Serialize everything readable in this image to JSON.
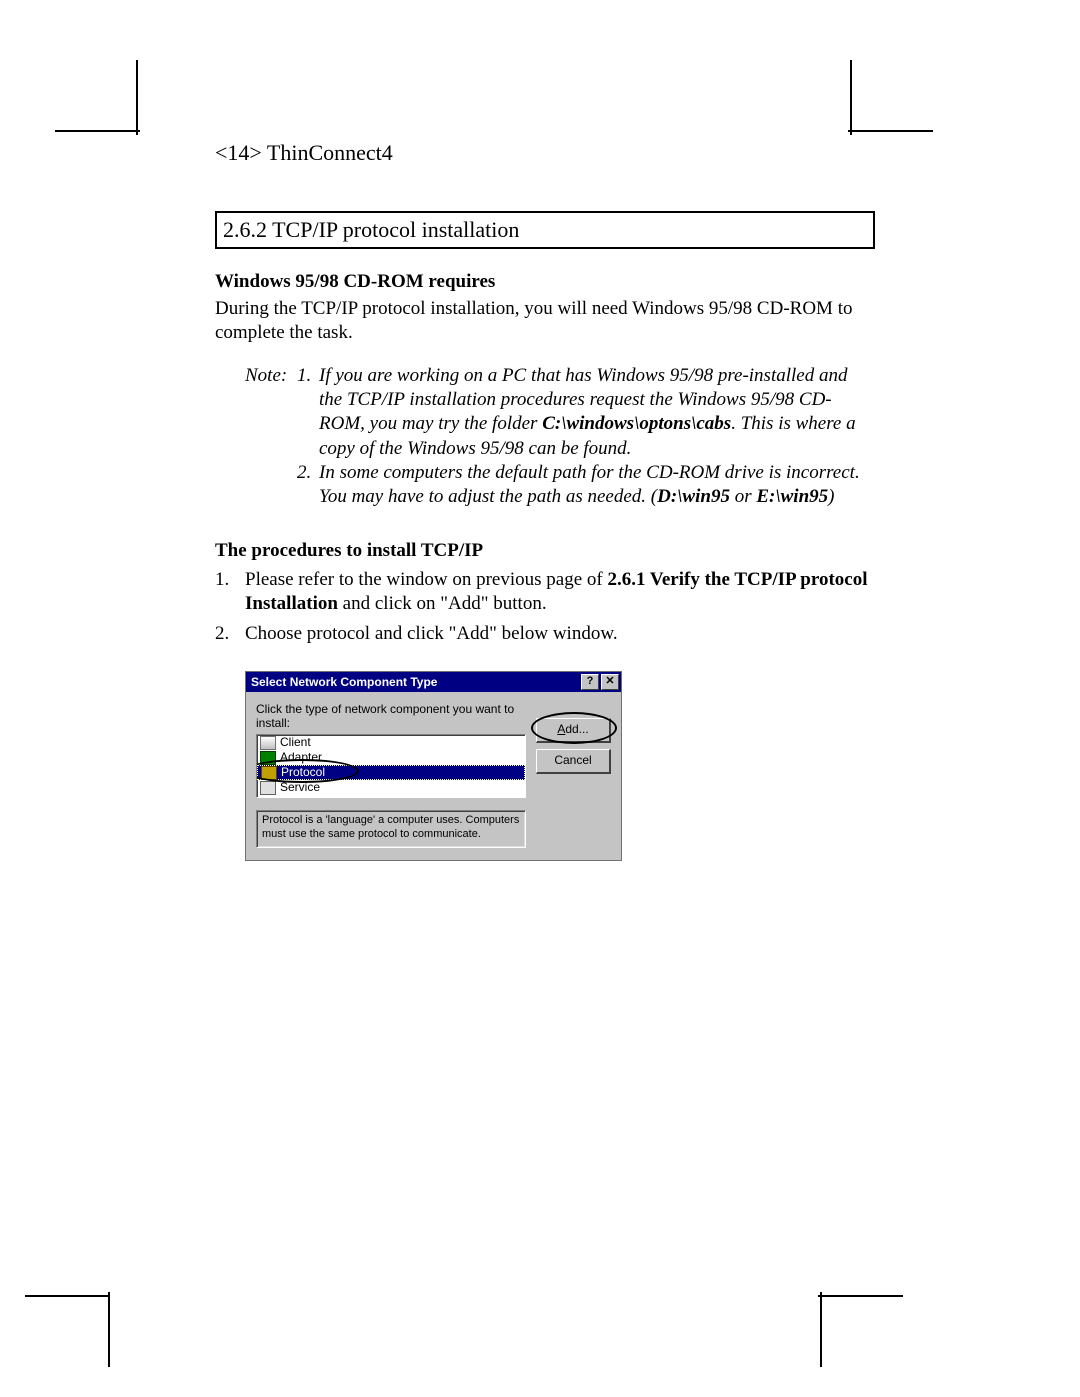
{
  "header": "<14> ThinConnect4",
  "section_title": "2.6.2 TCP/IP protocol installation",
  "sub1_heading": "Windows 95/98 CD-ROM requires",
  "sub1_body": "During the TCP/IP protocol installation, you will need Windows 95/98 CD-ROM to complete the task.",
  "note": {
    "label": "Note:",
    "items": [
      {
        "num": "1.",
        "pre": "If you are working on a PC that has Windows 95/98 pre-installed and the TCP/IP installation procedures request the Windows 95/98 CD-ROM, you may try the folder ",
        "bold": "C:\\windows\\optons\\cabs",
        "post": ". This is where a copy of the Windows 95/98 can be found."
      },
      {
        "num": "2.",
        "pre": "In some computers the default path for the CD-ROM drive is incorrect. You may have to adjust the path as needed. (",
        "bold": "D:\\win95",
        "mid": " or ",
        "bold2": "E:\\win95",
        "post": ")"
      }
    ]
  },
  "proc_heading": "The procedures to install TCP/IP",
  "proc_items": [
    {
      "num": "1.",
      "pre": "Please refer to the window on previous page of ",
      "bold": "2.6.1 Verify the TCP/IP protocol Installation",
      "post": " and click on \"Add\" button."
    },
    {
      "num": "2.",
      "pre": "Choose protocol and click \"Add\" below window.",
      "bold": "",
      "post": ""
    }
  ],
  "dialog": {
    "title": "Select Network Component Type",
    "help_icon": "?",
    "close_icon": "✕",
    "instruction": "Click the type of network component you want to install:",
    "list": [
      {
        "label": "Client",
        "selected": false,
        "icon": "icon-client"
      },
      {
        "label": "Adapter",
        "selected": false,
        "icon": "icon-adapter"
      },
      {
        "label": "Protocol",
        "selected": true,
        "icon": "icon-protocol"
      },
      {
        "label": "Service",
        "selected": false,
        "icon": "icon-service"
      }
    ],
    "description": "Protocol is a 'language' a computer uses. Computers must use the same protocol to communicate.",
    "add_btn": {
      "ul": "A",
      "rest": "dd..."
    },
    "cancel_btn": "Cancel"
  }
}
